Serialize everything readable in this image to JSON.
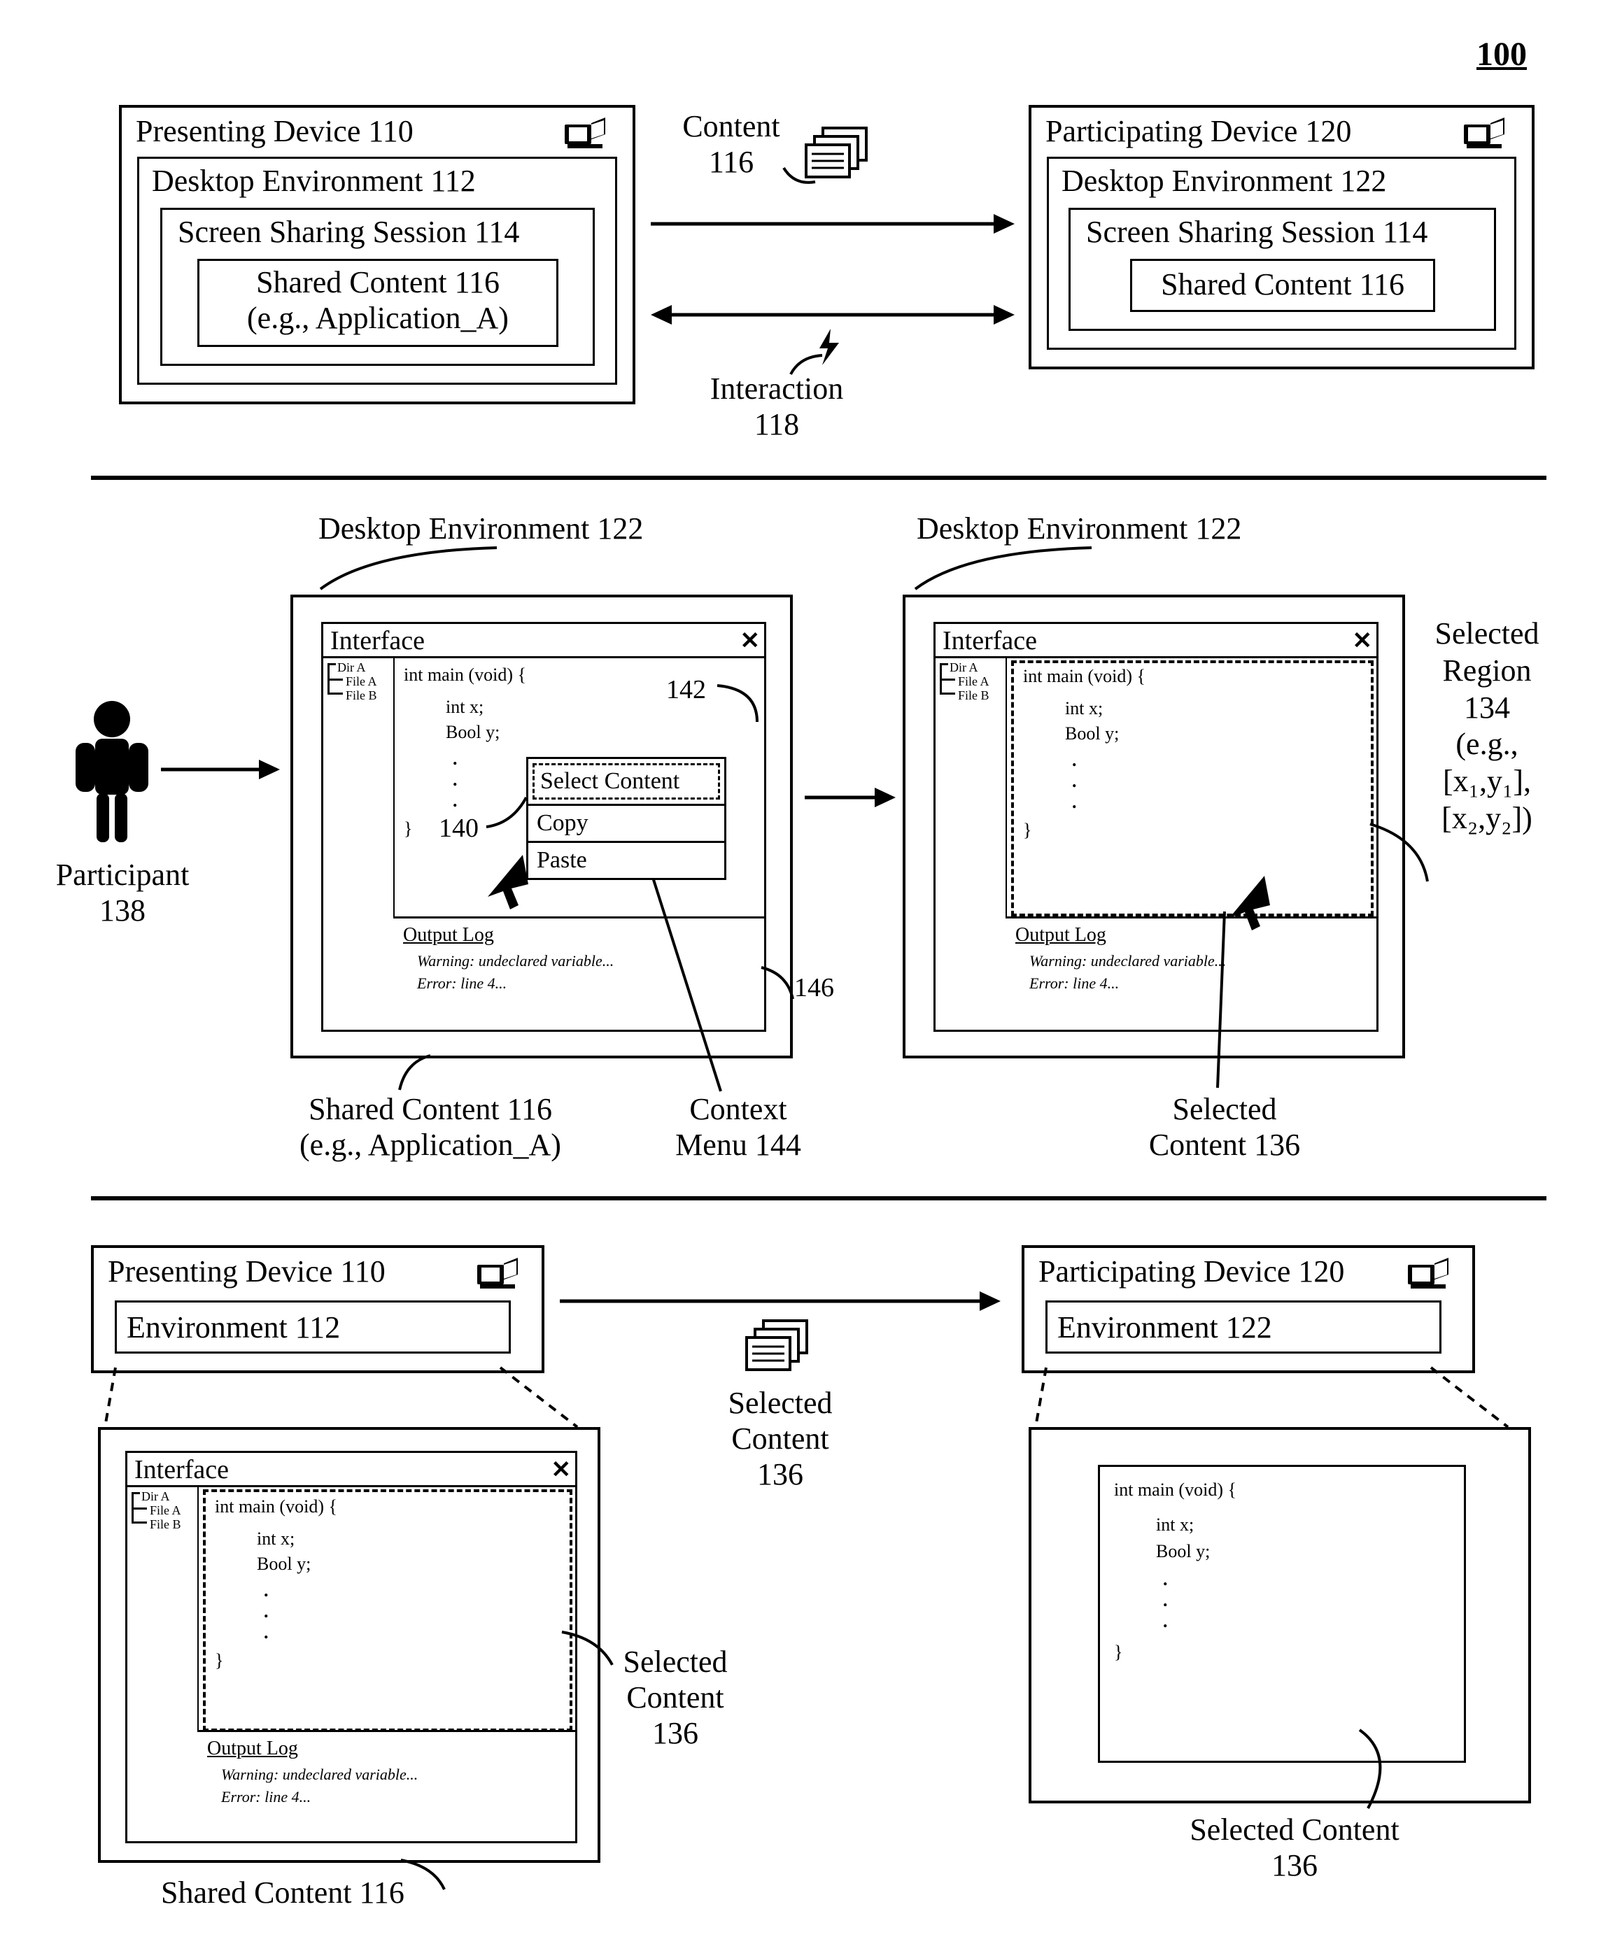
{
  "figure_number": "100",
  "top": {
    "presenting": {
      "title": "Presenting Device 110",
      "env": "Desktop Environment 112",
      "session": "Screen Sharing Session 114",
      "shared1": "Shared Content 116",
      "shared2": "(e.g., Application_A)"
    },
    "participating": {
      "title": "Participating Device 120",
      "env": "Desktop Environment 122",
      "session": "Screen Sharing Session 114",
      "shared": "Shared Content 116"
    },
    "content_label1": "Content",
    "content_label2": "116",
    "interaction1": "Interaction",
    "interaction2": "118"
  },
  "mid": {
    "left_env_label": "Desktop Environment 122",
    "right_env_label": "Desktop Environment 122",
    "participant1": "Participant",
    "participant2": "138",
    "interface_title": "Interface",
    "close_x": "✕",
    "tree": {
      "dir": "Dir A",
      "file1": "File A",
      "file2": "File B"
    },
    "code_main": "int main (void)  {",
    "code_x": "int x;",
    "code_y": "Bool y;",
    "code_close": "}",
    "ref_142": "142",
    "ref_140": "140",
    "ref_146": "146",
    "menu": {
      "select": "Select Content",
      "copy": "Copy",
      "paste": "Paste"
    },
    "output_title": "Output Log",
    "output_warn": "Warning: undeclared variable...",
    "output_err": "Error: line 4...",
    "shared_label1": "Shared Content 116",
    "shared_label2": "(e.g., Application_A)",
    "context_label1": "Context",
    "context_label2": "Menu 144",
    "selected_region1": "Selected",
    "selected_region2": "Region",
    "selected_region3": "134",
    "selected_region4": "(e.g.,",
    "selected_region5": "[x₁,y₁],",
    "selected_region6": "[x₂,y₂])",
    "selected_content1": "Selected",
    "selected_content2": "Content 136"
  },
  "bot": {
    "presenting_title": "Presenting Device 110",
    "presenting_env": "Environment 112",
    "participating_title": "Participating Device 120",
    "participating_env": "Environment 122",
    "selected1": "Selected",
    "selected2": "Content",
    "selected3": "136",
    "sel_content_right1": "Selected Content",
    "sel_content_right2": "136",
    "sel_content_left1": "Selected",
    "sel_content_left2": "Content",
    "sel_content_left3": "136",
    "shared_bottom": "Shared Content 116"
  }
}
